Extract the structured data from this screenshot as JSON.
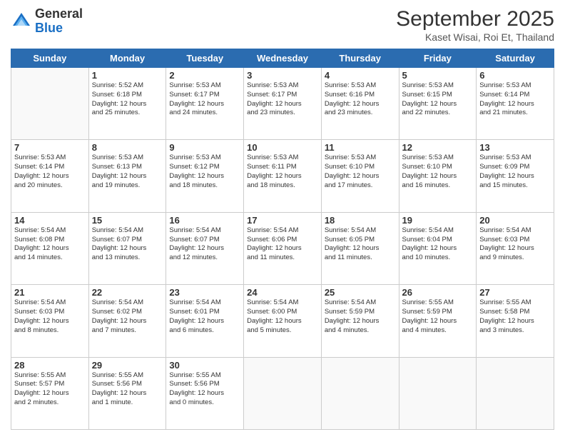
{
  "logo": {
    "line1": "General",
    "line2": "Blue"
  },
  "title": "September 2025",
  "subtitle": "Kaset Wisai, Roi Et, Thailand",
  "days_of_week": [
    "Sunday",
    "Monday",
    "Tuesday",
    "Wednesday",
    "Thursday",
    "Friday",
    "Saturday"
  ],
  "weeks": [
    [
      {
        "day": "",
        "info": ""
      },
      {
        "day": "1",
        "info": "Sunrise: 5:52 AM\nSunset: 6:18 PM\nDaylight: 12 hours\nand 25 minutes."
      },
      {
        "day": "2",
        "info": "Sunrise: 5:53 AM\nSunset: 6:17 PM\nDaylight: 12 hours\nand 24 minutes."
      },
      {
        "day": "3",
        "info": "Sunrise: 5:53 AM\nSunset: 6:17 PM\nDaylight: 12 hours\nand 23 minutes."
      },
      {
        "day": "4",
        "info": "Sunrise: 5:53 AM\nSunset: 6:16 PM\nDaylight: 12 hours\nand 23 minutes."
      },
      {
        "day": "5",
        "info": "Sunrise: 5:53 AM\nSunset: 6:15 PM\nDaylight: 12 hours\nand 22 minutes."
      },
      {
        "day": "6",
        "info": "Sunrise: 5:53 AM\nSunset: 6:14 PM\nDaylight: 12 hours\nand 21 minutes."
      }
    ],
    [
      {
        "day": "7",
        "info": "Sunrise: 5:53 AM\nSunset: 6:14 PM\nDaylight: 12 hours\nand 20 minutes."
      },
      {
        "day": "8",
        "info": "Sunrise: 5:53 AM\nSunset: 6:13 PM\nDaylight: 12 hours\nand 19 minutes."
      },
      {
        "day": "9",
        "info": "Sunrise: 5:53 AM\nSunset: 6:12 PM\nDaylight: 12 hours\nand 18 minutes."
      },
      {
        "day": "10",
        "info": "Sunrise: 5:53 AM\nSunset: 6:11 PM\nDaylight: 12 hours\nand 18 minutes."
      },
      {
        "day": "11",
        "info": "Sunrise: 5:53 AM\nSunset: 6:10 PM\nDaylight: 12 hours\nand 17 minutes."
      },
      {
        "day": "12",
        "info": "Sunrise: 5:53 AM\nSunset: 6:10 PM\nDaylight: 12 hours\nand 16 minutes."
      },
      {
        "day": "13",
        "info": "Sunrise: 5:53 AM\nSunset: 6:09 PM\nDaylight: 12 hours\nand 15 minutes."
      }
    ],
    [
      {
        "day": "14",
        "info": "Sunrise: 5:54 AM\nSunset: 6:08 PM\nDaylight: 12 hours\nand 14 minutes."
      },
      {
        "day": "15",
        "info": "Sunrise: 5:54 AM\nSunset: 6:07 PM\nDaylight: 12 hours\nand 13 minutes."
      },
      {
        "day": "16",
        "info": "Sunrise: 5:54 AM\nSunset: 6:07 PM\nDaylight: 12 hours\nand 12 minutes."
      },
      {
        "day": "17",
        "info": "Sunrise: 5:54 AM\nSunset: 6:06 PM\nDaylight: 12 hours\nand 11 minutes."
      },
      {
        "day": "18",
        "info": "Sunrise: 5:54 AM\nSunset: 6:05 PM\nDaylight: 12 hours\nand 11 minutes."
      },
      {
        "day": "19",
        "info": "Sunrise: 5:54 AM\nSunset: 6:04 PM\nDaylight: 12 hours\nand 10 minutes."
      },
      {
        "day": "20",
        "info": "Sunrise: 5:54 AM\nSunset: 6:03 PM\nDaylight: 12 hours\nand 9 minutes."
      }
    ],
    [
      {
        "day": "21",
        "info": "Sunrise: 5:54 AM\nSunset: 6:03 PM\nDaylight: 12 hours\nand 8 minutes."
      },
      {
        "day": "22",
        "info": "Sunrise: 5:54 AM\nSunset: 6:02 PM\nDaylight: 12 hours\nand 7 minutes."
      },
      {
        "day": "23",
        "info": "Sunrise: 5:54 AM\nSunset: 6:01 PM\nDaylight: 12 hours\nand 6 minutes."
      },
      {
        "day": "24",
        "info": "Sunrise: 5:54 AM\nSunset: 6:00 PM\nDaylight: 12 hours\nand 5 minutes."
      },
      {
        "day": "25",
        "info": "Sunrise: 5:54 AM\nSunset: 5:59 PM\nDaylight: 12 hours\nand 4 minutes."
      },
      {
        "day": "26",
        "info": "Sunrise: 5:55 AM\nSunset: 5:59 PM\nDaylight: 12 hours\nand 4 minutes."
      },
      {
        "day": "27",
        "info": "Sunrise: 5:55 AM\nSunset: 5:58 PM\nDaylight: 12 hours\nand 3 minutes."
      }
    ],
    [
      {
        "day": "28",
        "info": "Sunrise: 5:55 AM\nSunset: 5:57 PM\nDaylight: 12 hours\nand 2 minutes."
      },
      {
        "day": "29",
        "info": "Sunrise: 5:55 AM\nSunset: 5:56 PM\nDaylight: 12 hours\nand 1 minute."
      },
      {
        "day": "30",
        "info": "Sunrise: 5:55 AM\nSunset: 5:56 PM\nDaylight: 12 hours\nand 0 minutes."
      },
      {
        "day": "",
        "info": ""
      },
      {
        "day": "",
        "info": ""
      },
      {
        "day": "",
        "info": ""
      },
      {
        "day": "",
        "info": ""
      }
    ]
  ]
}
